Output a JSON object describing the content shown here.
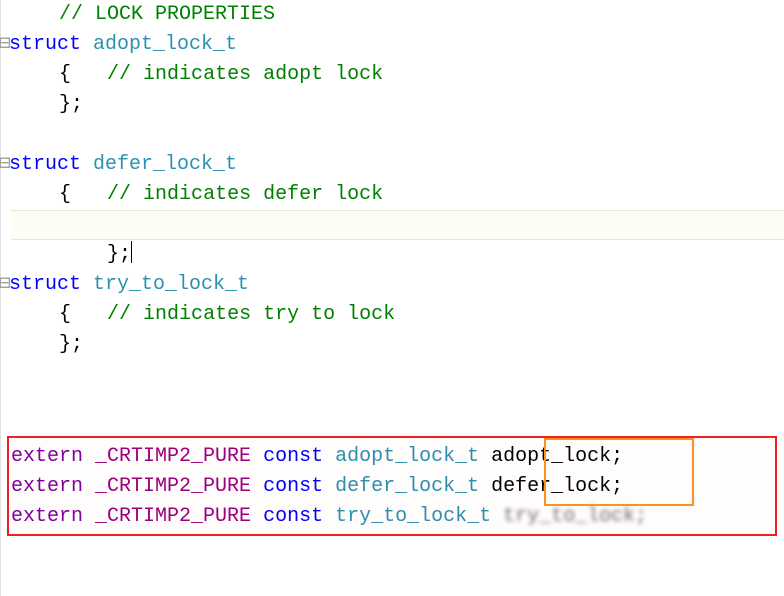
{
  "lines": {
    "l1_ws": "    ",
    "l1_comment": "// LOCK PROPERTIES",
    "l2_kw": "struct",
    "l2_sp": " ",
    "l2_type": "adopt_lock_t",
    "l3_ws": "    ",
    "l3_brace": "{",
    "l3_sp": "   ",
    "l3_comment": "// indicates adopt lock",
    "l4_ws": "    ",
    "l4_rbrace": "};",
    "l5": "",
    "l6_kw": "struct",
    "l6_sp": " ",
    "l6_type": "defer_lock_t",
    "l7_ws": "    ",
    "l7_brace": "{",
    "l7_sp": "   ",
    "l7_comment": "// indicates defer lock",
    "l8_ws": "    ",
    "l8_rbrace": "};",
    "l9": "",
    "l10_kw": "struct",
    "l10_sp": " ",
    "l10_type": "try_to_lock_t",
    "l11_ws": "    ",
    "l11_brace": "{",
    "l11_sp": "   ",
    "l11_comment": "// indicates try to lock",
    "l12_ws": "    ",
    "l12_rbrace": "};",
    "l13": "",
    "e1_kw": "extern",
    "e1_sp1": " ",
    "e1_macro": "_CRTIMP2_PURE",
    "e1_sp2": " ",
    "e1_const": "const",
    "e1_sp3": " ",
    "e1_type": "adopt_lock_t",
    "e1_sp4": " ",
    "e1_var": "adopt_lock;",
    "e2_kw": "extern",
    "e2_sp1": " ",
    "e2_macro": "_CRTIMP2_PURE",
    "e2_sp2": " ",
    "e2_const": "const",
    "e2_sp3": " ",
    "e2_type": "defer_lock_t",
    "e2_sp4": " ",
    "e2_var": "defer_lock;",
    "e3_kw": "extern",
    "e3_sp1": " ",
    "e3_macro": "_CRTIMP2_PURE",
    "e3_sp2": " ",
    "e3_const": "const",
    "e3_sp3": " ",
    "e3_type": "try_to_lock_t",
    "e3_sp4": " ",
    "e3_var": "try_to_lock;"
  }
}
